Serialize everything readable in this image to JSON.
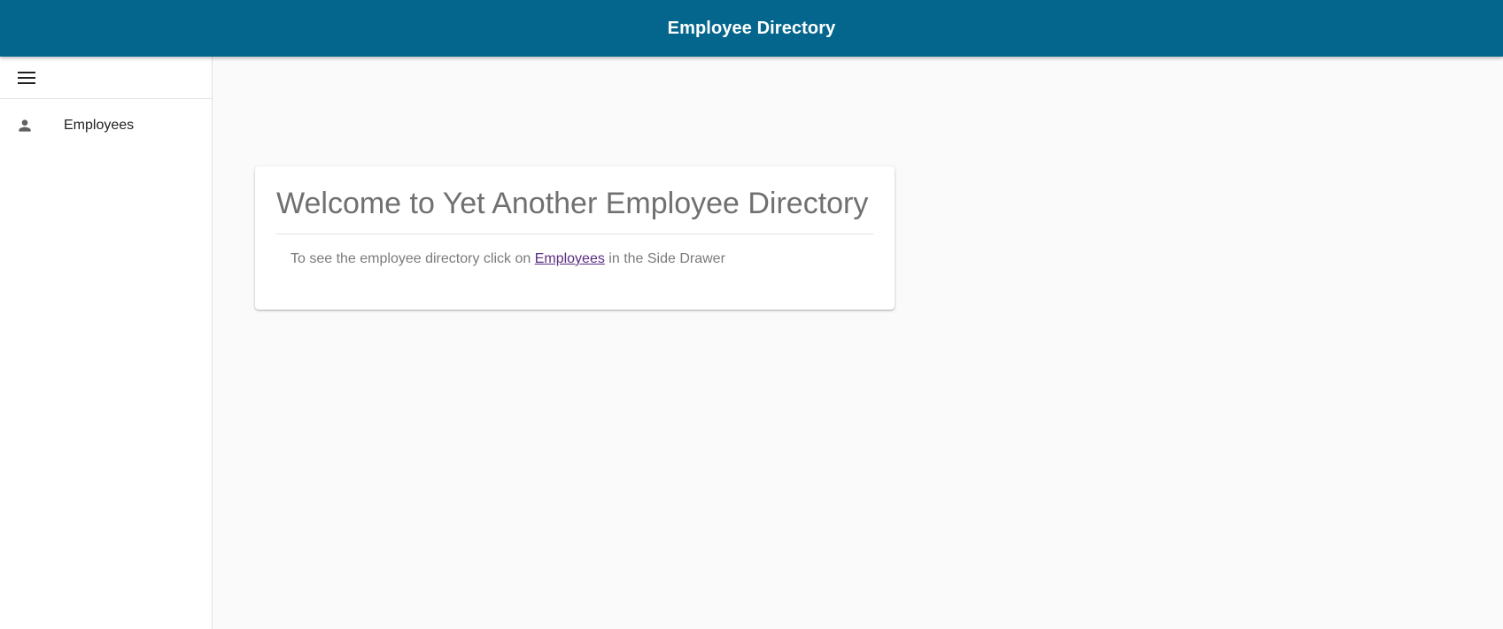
{
  "appbar": {
    "title": "Employee Directory",
    "background": "#05668d"
  },
  "drawer": {
    "menu_icon": "menu-icon",
    "items": [
      {
        "label": "Employees",
        "icon": "person-icon"
      }
    ]
  },
  "main": {
    "card": {
      "title": "Welcome to Yet Another Employee Directory",
      "text_before": "To see the employee directory click on ",
      "link_text": "Employees",
      "text_after": " in the Side Drawer",
      "link_color": "#5a2d82"
    }
  }
}
